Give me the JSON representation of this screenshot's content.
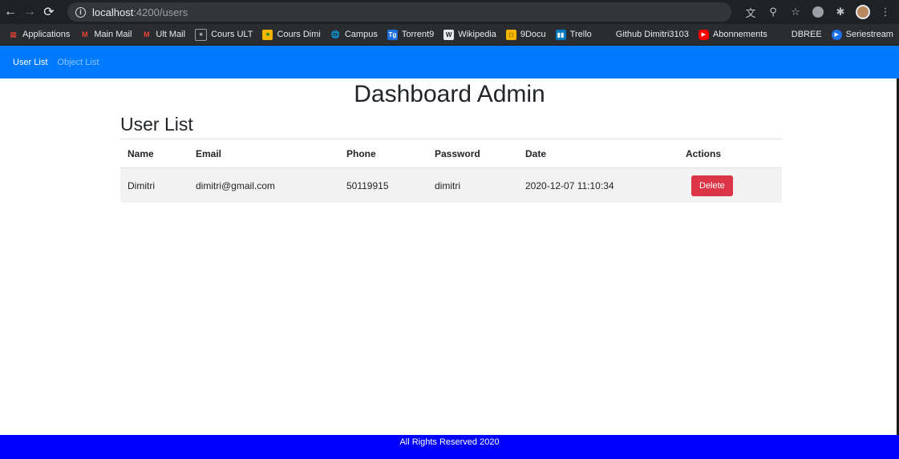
{
  "browser": {
    "url_host": "localhost",
    "url_path": ":4200/users",
    "bookmarks": [
      {
        "label": "Applications",
        "icon": "apps-grid-icon",
        "color": "#ea4335"
      },
      {
        "label": "Main Mail",
        "icon": "gmail-icon",
        "color": "#ea4335"
      },
      {
        "label": "Ult Mail",
        "icon": "gmail-icon",
        "color": "#ea4335"
      },
      {
        "label": "Cours ULT",
        "icon": "classroom-icon",
        "color": "#9aa0a6"
      },
      {
        "label": "Cours Dimi",
        "icon": "classroom-icon",
        "color": "#f4b400"
      },
      {
        "label": "Campus",
        "icon": "globe-icon",
        "color": "#e8eaed"
      },
      {
        "label": "Torrent9",
        "icon": "torrent-icon",
        "color": "#1e6fd9"
      },
      {
        "label": "Wikipedia",
        "icon": "wikipedia-icon",
        "color": "#e8eaed"
      },
      {
        "label": "9Docu",
        "icon": "docu-icon",
        "color": "#f4b400"
      },
      {
        "label": "Trello",
        "icon": "trello-icon",
        "color": "#0079bf"
      },
      {
        "label": "Github Dimitri3103",
        "icon": "github-icon",
        "color": "#2b2c2f"
      },
      {
        "label": "Abonnements",
        "icon": "youtube-icon",
        "color": "#ff0000"
      },
      {
        "label": "DBREE",
        "icon": "dbree-icon",
        "color": "#2b2c2f"
      },
      {
        "label": "Seriestream",
        "icon": "play-icon",
        "color": "#1a73e8"
      }
    ],
    "more": "»"
  },
  "navbar": {
    "items": [
      {
        "label": "User List",
        "active": true
      },
      {
        "label": "Object List",
        "active": false
      }
    ]
  },
  "page": {
    "title": "Dashboard Admin",
    "section_title": "User List"
  },
  "table": {
    "headers": [
      "Name",
      "Email",
      "Phone",
      "Password",
      "Date",
      "Actions"
    ],
    "rows": [
      {
        "name": "Dimitri",
        "email": "dimitri@gmail.com",
        "phone": "50119915",
        "password": "dimitri",
        "date": "2020-12-07 11:10:34",
        "action": "Delete"
      }
    ]
  },
  "footer": {
    "text": "All Rights Reserved 2020"
  },
  "colors": {
    "navbar": "#007bff",
    "footer": "#0000ff",
    "danger": "#dc3545"
  }
}
